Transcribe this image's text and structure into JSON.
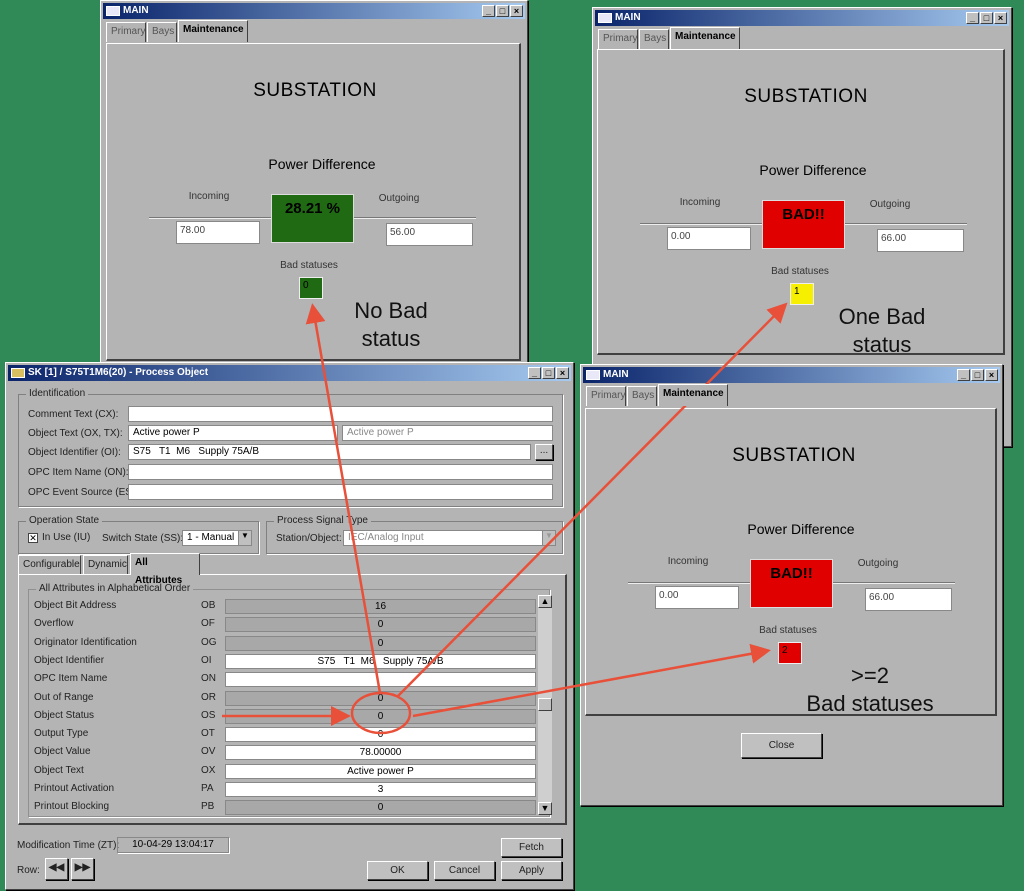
{
  "main_tabs": [
    "Primary",
    "Bays",
    "Maintenance"
  ],
  "main_labels": {
    "title": "MAIN",
    "substation": "SUBSTATION",
    "power_difference": "Power Difference",
    "incoming": "Incoming",
    "outgoing": "Outgoing",
    "bad_statuses": "Bad statuses",
    "close": "Close"
  },
  "window_a": {
    "percent": "28.21 %",
    "incoming": "78.00",
    "outgoing": "56.00",
    "bad_count": "0",
    "box_color": "#1f6a12",
    "status_color": "#1f6a12",
    "note1": "No Bad",
    "note2": "status"
  },
  "window_b": {
    "percent": "BAD!!",
    "incoming": "0.00",
    "outgoing": "66.00",
    "bad_count": "1",
    "box_color": "#e00000",
    "status_color": "#f6f000",
    "note1": "One Bad",
    "note2": "status"
  },
  "window_c": {
    "percent": "BAD!!",
    "incoming": "0.00",
    "outgoing": "66.00",
    "bad_count": "2",
    "box_color": "#e00000",
    "status_color": "#e00000",
    "note1": ">=2",
    "note2": "Bad statuses"
  },
  "process": {
    "title": "SK [1] / S75T1M6(20) - Process Object",
    "identification": "Identification",
    "comment_label": "Comment Text (CX):",
    "comment_value": "",
    "object_text_label": "Object Text (OX, TX):",
    "object_text_value": "Active power P",
    "object_text_value2": "Active power P",
    "object_id_label": "Object Identifier (OI):",
    "object_id_value": "S75   T1  M6   Supply 75A/B",
    "browse": "...",
    "opc_item_label": "OPC Item Name (ON):",
    "opc_item_value": "",
    "opc_event_label": "OPC Event Source (ES):",
    "opc_event_value": "",
    "operation_state": "Operation State",
    "in_use": "In Use (IU)",
    "in_use_checked": true,
    "switch_state_label": "Switch State (SS):",
    "switch_state_value": "1 - Manual",
    "process_signal_type": "Process Signal Type",
    "station_object_label": "Station/Object:",
    "station_object_value": "IEC/Analog Input",
    "tabs": [
      "Configurable",
      "Dynamic",
      "All Attributes"
    ],
    "attr_group": "All Attributes in Alphabetical Order",
    "attributes": [
      {
        "name": "Object Bit Address",
        "code": "OB",
        "value": "16",
        "readonly": true
      },
      {
        "name": "Overflow",
        "code": "OF",
        "value": "0",
        "readonly": true
      },
      {
        "name": "Originator Identification",
        "code": "OG",
        "value": "0",
        "readonly": true
      },
      {
        "name": "Object Identifier",
        "code": "OI",
        "value": "S75   T1  M6   Supply 75A/B",
        "readonly": false
      },
      {
        "name": "OPC Item Name",
        "code": "ON",
        "value": "",
        "readonly": false
      },
      {
        "name": "Out of Range",
        "code": "OR",
        "value": "0",
        "readonly": true
      },
      {
        "name": "Object Status",
        "code": "OS",
        "value": "0",
        "readonly": true
      },
      {
        "name": "Output Type",
        "code": "OT",
        "value": "0",
        "readonly": false
      },
      {
        "name": "Object Value",
        "code": "OV",
        "value": "78.00000",
        "readonly": false
      },
      {
        "name": "Object Text",
        "code": "OX",
        "value": "Active power P",
        "readonly": false
      },
      {
        "name": "Printout Activation",
        "code": "PA",
        "value": "3",
        "readonly": false
      },
      {
        "name": "Printout Blocking",
        "code": "PB",
        "value": "0",
        "readonly": true
      }
    ],
    "mod_time_label": "Modification Time (ZT):",
    "mod_time_value": "10-04-29 13:04:17",
    "row_label": "Row:",
    "fetch": "Fetch",
    "ok": "OK",
    "cancel": "Cancel",
    "apply": "Apply"
  },
  "annotation_color": "#e8503a"
}
